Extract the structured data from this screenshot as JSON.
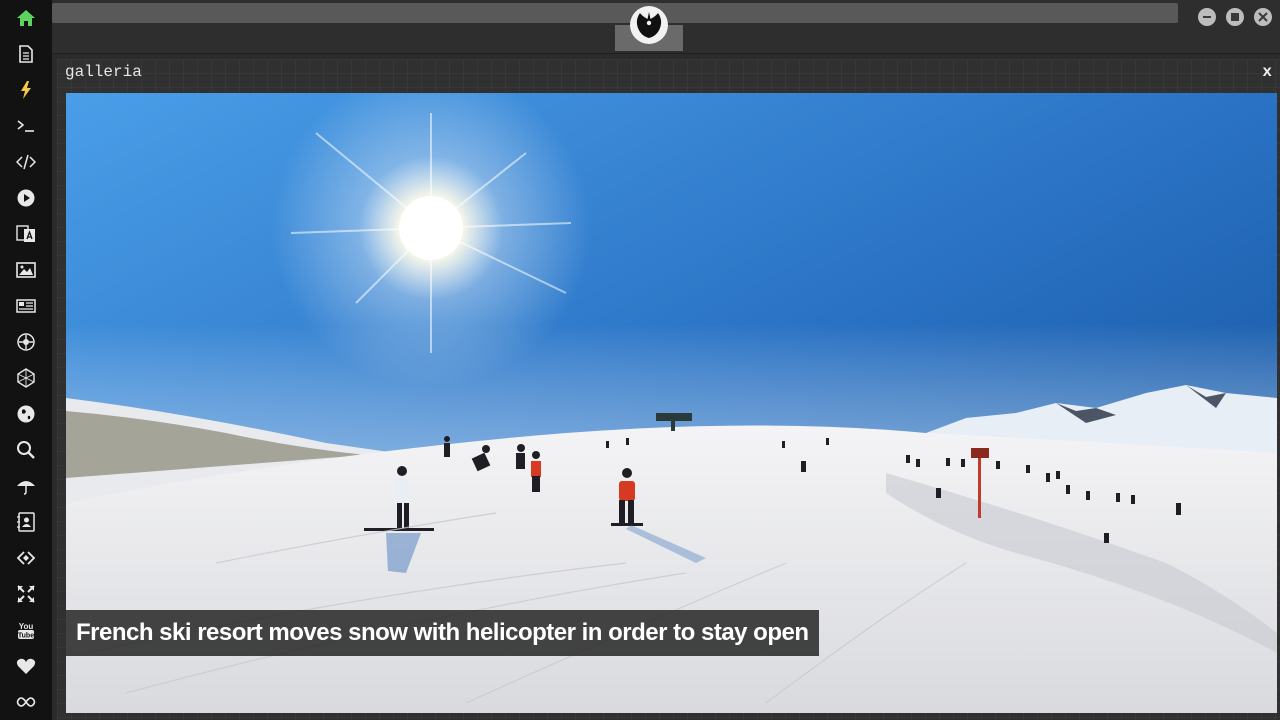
{
  "window": {
    "panel_title": "galleria",
    "close_label": "x"
  },
  "sidebar": {
    "icons": [
      "home-icon",
      "document-icon",
      "lightning-icon",
      "terminal-icon",
      "code-icon",
      "play-icon",
      "translate-icon",
      "image-icon",
      "news-icon",
      "settings-icon",
      "network-icon",
      "globe-icon",
      "search-icon",
      "umbrella-icon",
      "contact-icon",
      "brackets-icon",
      "expand-icon",
      "youtube-icon",
      "heart-icon",
      "infinity-icon"
    ],
    "youtube_text": "You\nTube"
  },
  "gallery": {
    "caption": "French ski resort moves snow with helicopter in order to stay open"
  },
  "colors": {
    "accent": "#5fd35f",
    "sidebar_bg": "#121212",
    "panel_bg": "#303030"
  }
}
